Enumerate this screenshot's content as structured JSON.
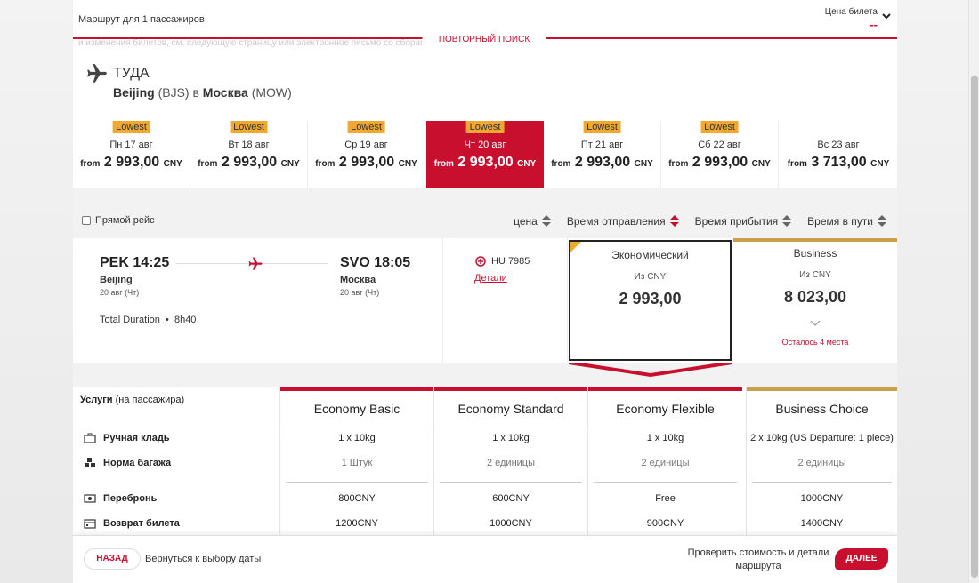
{
  "topbar": {
    "route_label": "Маршрут для 1 пассажиров",
    "price_label": "Цена билета",
    "price_value": "--",
    "faded_text": "и изменения билетов, см. следующую страницу или электронное письмо со сборами",
    "research_tab": "ПОВТОРНЫЙ ПОИСК"
  },
  "direction": {
    "title": "ТУДА",
    "from_city": "Beijing",
    "from_code": "(BJS)",
    "connector": "в",
    "to_city": "Москва",
    "to_code": "(MOW)"
  },
  "dates": [
    {
      "badge": "Lowest",
      "label": "Пн 17 авг",
      "from": "from",
      "price": "2 993,00",
      "currency": "CNY",
      "active": false
    },
    {
      "badge": "Lowest",
      "label": "Вт 18 авг",
      "from": "from",
      "price": "2 993,00",
      "currency": "CNY",
      "active": false
    },
    {
      "badge": "Lowest",
      "label": "Ср 19 авг",
      "from": "from",
      "price": "2 993,00",
      "currency": "CNY",
      "active": false
    },
    {
      "badge": "Lowest",
      "label": "Чт 20 авг",
      "from": "from",
      "price": "2 993,00",
      "currency": "CNY",
      "active": true
    },
    {
      "badge": "Lowest",
      "label": "Пт 21 авг",
      "from": "from",
      "price": "2 993,00",
      "currency": "CNY",
      "active": false
    },
    {
      "badge": "Lowest",
      "label": "Сб 22 авг",
      "from": "from",
      "price": "2 993,00",
      "currency": "CNY",
      "active": false
    },
    {
      "badge": "",
      "label": "Вс 23 авг",
      "from": "from",
      "price": "3 713,00",
      "currency": "CNY",
      "active": false
    }
  ],
  "filters": {
    "direct_label": "Прямой рейс",
    "sort_price": "цена",
    "sort_departure": "Время отправления",
    "sort_arrival": "Время прибытия",
    "sort_duration": "Время в пути"
  },
  "flight": {
    "dep_code": "PEK",
    "dep_time": "14:25",
    "dep_city": "Beijing",
    "dep_date": "20 авг (Чт)",
    "arr_code": "SVO",
    "arr_time": "18:05",
    "arr_city": "Москва",
    "arr_date": "20 авг (Чт)",
    "total_label": "Total Duration",
    "total_value": "8h40",
    "flight_no": "HU 7985",
    "details": "Детали"
  },
  "fares": {
    "economy": {
      "name": "Экономический",
      "from": "Из CNY",
      "price": "2 993,00"
    },
    "business": {
      "name": "Business",
      "from": "Из CNY",
      "price": "8 023,00",
      "seats": "Осталось 4 места"
    }
  },
  "services": {
    "header": "Услуги",
    "header_sub": "(на пассажира)",
    "rows": [
      "Ручная кладь",
      "Норма багажа",
      "Перебронь",
      "Возврат билета"
    ],
    "columns": [
      {
        "name": "Economy Basic",
        "values": [
          "1 x 10kg",
          "1 Штук",
          "800CNY",
          "1200CNY"
        ]
      },
      {
        "name": "Economy Standard",
        "values": [
          "1 x 10kg",
          "2 единицы",
          "600CNY",
          "1000CNY"
        ]
      },
      {
        "name": "Economy Flexible",
        "values": [
          "1 x 10kg",
          "2 единицы",
          "Free",
          "900CNY"
        ]
      },
      {
        "name": "Business Choice",
        "values": [
          "2 x 10kg (US Departure: 1 piece)",
          "2 единицы",
          "1000CNY",
          "1400CNY"
        ]
      }
    ]
  },
  "bottombar": {
    "back_label": "НАЗАД",
    "back_text": "Вернуться к выбору даты",
    "check_text": "Проверить стоимость и детали маршрута",
    "next_label": "ДАЛЕЕ"
  },
  "colors": {
    "accent": "#c8102e",
    "lowest_badge": "#f0a830",
    "business_gold": "#c9a04a"
  }
}
